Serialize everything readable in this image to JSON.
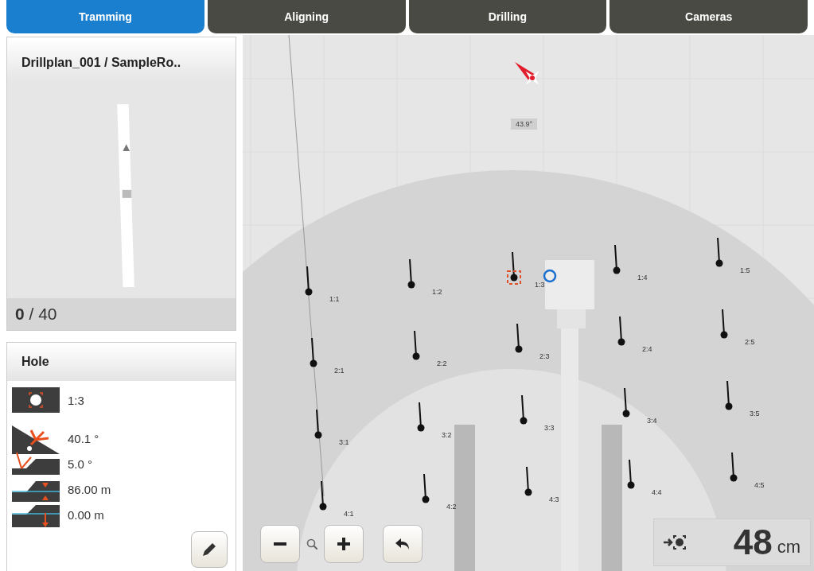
{
  "tabs": [
    {
      "label": "Tramming",
      "selected": true
    },
    {
      "label": "Aligning",
      "selected": false
    },
    {
      "label": "Drilling",
      "selected": false
    },
    {
      "label": "Cameras",
      "selected": false
    }
  ],
  "plan": {
    "title": "Drillplan_001 / SampleRo..",
    "counter": "**0** / 40"
  },
  "hole": {
    "title": "Hole",
    "fields": [
      {
        "kind": "position",
        "value": "1:3"
      },
      {
        "kind": "inclination",
        "value": "40.1 °"
      },
      {
        "kind": "angle",
        "value": "5.0 °"
      },
      {
        "kind": "depth",
        "value": "86.00 m"
      },
      {
        "kind": "offset",
        "value": "0.00 m"
      }
    ]
  },
  "map": {
    "heading": "43.9°",
    "distance": {
      "value": "48",
      "unit": "cm"
    },
    "holes": [
      [
        {
          "label": "1:1",
          "selected": false
        },
        {
          "label": "1:2",
          "selected": false
        },
        {
          "label": "1:3",
          "selected": true
        },
        {
          "label": "1:4",
          "selected": false
        },
        {
          "label": "1:5",
          "selected": false
        }
      ],
      [
        {
          "label": "2:1",
          "selected": false
        },
        {
          "label": "2:2",
          "selected": false
        },
        {
          "label": "2:3",
          "selected": false
        },
        {
          "label": "2:4",
          "selected": false
        },
        {
          "label": "2:5",
          "selected": false
        }
      ],
      [
        {
          "label": "3:1",
          "selected": false
        },
        {
          "label": "3:2",
          "selected": false
        },
        {
          "label": "3:3",
          "selected": false
        },
        {
          "label": "3:4",
          "selected": false
        },
        {
          "label": "3:5",
          "selected": false
        }
      ],
      [
        {
          "label": "4:1",
          "selected": false
        },
        {
          "label": "4:2",
          "selected": false
        },
        {
          "label": "4:3",
          "selected": false
        },
        {
          "label": "4:4",
          "selected": false
        },
        {
          "label": "4:5",
          "selected": false
        }
      ]
    ]
  }
}
